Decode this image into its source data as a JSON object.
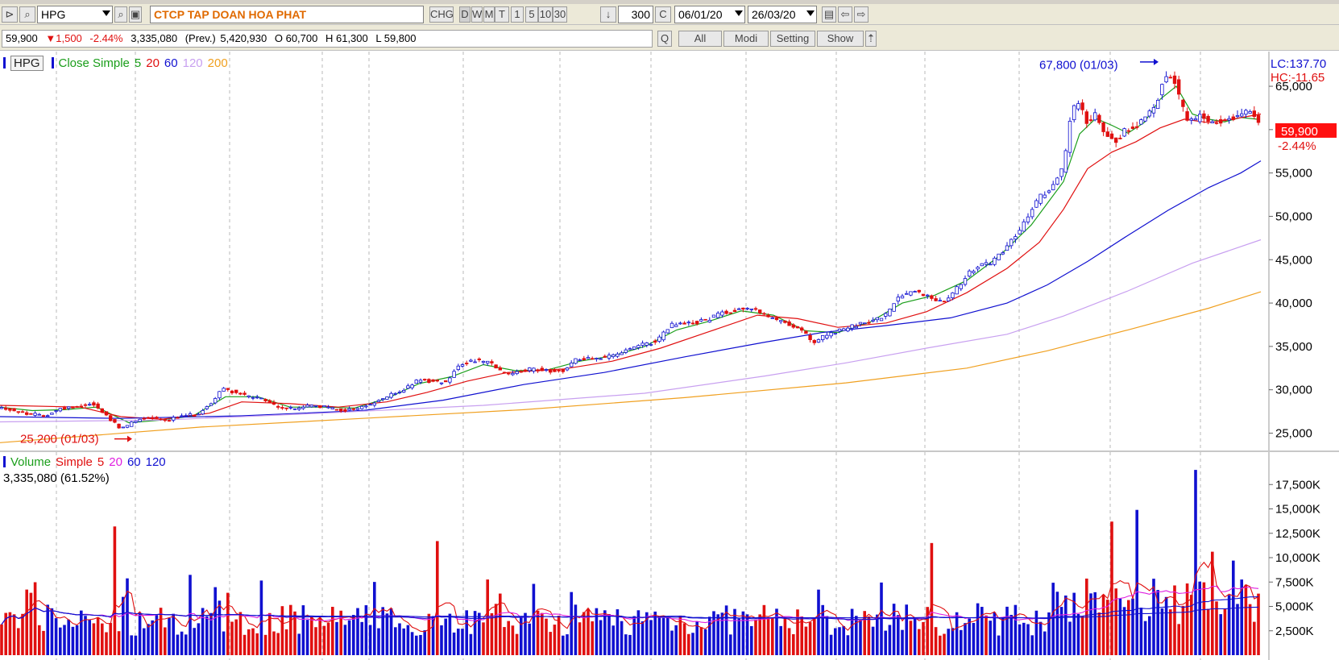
{
  "toolbar": {
    "symbol": "HPG",
    "company_name": "CTCP TAP DOAN HOA PHAT",
    "buttons": [
      "CHG",
      "D",
      "W",
      "M",
      "T",
      "1",
      "5",
      "10",
      "30"
    ],
    "bars_count": "300",
    "c_button": "C",
    "date_from": "06/01/20",
    "date_to": "26/03/20"
  },
  "quote": {
    "price": "59,900",
    "change": "▼1,500",
    "change_pct": "-2.44%",
    "volume": "3,335,080",
    "prev_label": "(Prev.)",
    "prev_volume": "5,420,930",
    "open": "O 60,700",
    "high": "H 61,300",
    "low": "L 59,800",
    "buttons": {
      "q": "Q",
      "all": "All",
      "modi": "Modi",
      "setting": "Setting",
      "show": "Show"
    }
  },
  "price_panel": {
    "symbol_badge": "HPG",
    "indicator": "Close Simple",
    "ma_periods": [
      "5",
      "20",
      "60",
      "120",
      "200"
    ],
    "ma_colors": [
      "#1a9e1a",
      "#e01010",
      "#1010d0",
      "#c8a0f0",
      "#f0a020"
    ],
    "lc_label": "LC:137.70",
    "hc_label": "HC:-11.65",
    "last_price": "59,900",
    "last_change_pct": "-2.44%",
    "high_annotation": "67,800 (01/03)",
    "low_annotation": "25,200 (01/03)",
    "y_ticks": [
      "65,000",
      "60,000",
      "55,000",
      "50,000",
      "45,000",
      "40,000",
      "35,000",
      "30,000",
      "25,000"
    ]
  },
  "volume_panel": {
    "title": "Volume",
    "indicator": "Simple",
    "ma_periods": [
      "5",
      "20",
      "60",
      "120"
    ],
    "ma_colors": [
      "#e01010",
      "#e020e0",
      "#1010d0",
      "#1010d0"
    ],
    "current_volume": "3,335,080 (61.52%)",
    "y_ticks": [
      "17,500K",
      "15,000K",
      "12,500K",
      "10,000K",
      "7,500K",
      "5,000K",
      "2,500K"
    ]
  },
  "chart_data": {
    "type": "candlestick",
    "price_ylim": [
      23000,
      69000
    ],
    "volume_ylim_k": [
      0,
      20000
    ],
    "price_path": [
      [
        0,
        28000
      ],
      [
        30,
        27300
      ],
      [
        55,
        27000
      ],
      [
        75,
        27800
      ],
      [
        95,
        28100
      ],
      [
        115,
        28400
      ],
      [
        135,
        26800
      ],
      [
        150,
        25400
      ],
      [
        165,
        26300
      ],
      [
        185,
        26900
      ],
      [
        205,
        26500
      ],
      [
        225,
        26900
      ],
      [
        245,
        27200
      ],
      [
        262,
        28400
      ],
      [
        275,
        30200
      ],
      [
        288,
        29800
      ],
      [
        305,
        29300
      ],
      [
        325,
        28900
      ],
      [
        345,
        28000
      ],
      [
        365,
        27800
      ],
      [
        385,
        28200
      ],
      [
        405,
        28000
      ],
      [
        425,
        27600
      ],
      [
        445,
        27900
      ],
      [
        465,
        28500
      ],
      [
        485,
        29400
      ],
      [
        505,
        30200
      ],
      [
        520,
        31200
      ],
      [
        540,
        30900
      ],
      [
        555,
        31000
      ],
      [
        570,
        33000
      ],
      [
        590,
        33400
      ],
      [
        610,
        33000
      ],
      [
        625,
        31800
      ],
      [
        645,
        32100
      ],
      [
        660,
        32400
      ],
      [
        680,
        32200
      ],
      [
        700,
        32200
      ],
      [
        715,
        33500
      ],
      [
        735,
        33700
      ],
      [
        755,
        33800
      ],
      [
        775,
        34400
      ],
      [
        795,
        35100
      ],
      [
        815,
        35600
      ],
      [
        835,
        37600
      ],
      [
        855,
        37600
      ],
      [
        875,
        38000
      ],
      [
        895,
        38800
      ],
      [
        915,
        39300
      ],
      [
        935,
        39500
      ],
      [
        955,
        38200
      ],
      [
        975,
        37800
      ],
      [
        995,
        36900
      ],
      [
        1010,
        35300
      ],
      [
        1025,
        36300
      ],
      [
        1045,
        36900
      ],
      [
        1065,
        37500
      ],
      [
        1085,
        38000
      ],
      [
        1100,
        38600
      ],
      [
        1115,
        40800
      ],
      [
        1135,
        41500
      ],
      [
        1155,
        40600
      ],
      [
        1170,
        40200
      ],
      [
        1185,
        41500
      ],
      [
        1200,
        43200
      ],
      [
        1215,
        44400
      ],
      [
        1230,
        44600
      ],
      [
        1245,
        46100
      ],
      [
        1260,
        47800
      ],
      [
        1275,
        49800
      ],
      [
        1290,
        52100
      ],
      [
        1305,
        53500
      ],
      [
        1320,
        55800
      ],
      [
        1330,
        62400
      ],
      [
        1340,
        62900
      ],
      [
        1350,
        60800
      ],
      [
        1360,
        62100
      ],
      [
        1372,
        59500
      ],
      [
        1385,
        58700
      ],
      [
        1395,
        59800
      ],
      [
        1410,
        60300
      ],
      [
        1425,
        62100
      ],
      [
        1435,
        63000
      ],
      [
        1445,
        66000
      ],
      [
        1455,
        66500
      ],
      [
        1465,
        63100
      ],
      [
        1475,
        60900
      ],
      [
        1490,
        61500
      ],
      [
        1505,
        60700
      ],
      [
        1520,
        61000
      ],
      [
        1535,
        61500
      ],
      [
        1545,
        62000
      ],
      [
        1555,
        61700
      ],
      [
        1565,
        60000
      ]
    ],
    "ma_series": [
      {
        "name": "5",
        "values": [
          [
            0,
            28000
          ],
          [
            40,
            27600
          ],
          [
            80,
            27700
          ],
          [
            120,
            28000
          ],
          [
            160,
            26200
          ],
          [
            200,
            26500
          ],
          [
            240,
            27000
          ],
          [
            280,
            29200
          ],
          [
            320,
            29200
          ],
          [
            360,
            28000
          ],
          [
            400,
            28000
          ],
          [
            440,
            27900
          ],
          [
            480,
            29000
          ],
          [
            520,
            30700
          ],
          [
            560,
            31500
          ],
          [
            600,
            32900
          ],
          [
            640,
            32200
          ],
          [
            680,
            32300
          ],
          [
            720,
            33300
          ],
          [
            760,
            33900
          ],
          [
            800,
            35000
          ],
          [
            840,
            36900
          ],
          [
            880,
            37900
          ],
          [
            920,
            39100
          ],
          [
            960,
            38600
          ],
          [
            1000,
            36800
          ],
          [
            1040,
            36600
          ],
          [
            1080,
            37800
          ],
          [
            1120,
            40000
          ],
          [
            1160,
            40900
          ],
          [
            1200,
            42600
          ],
          [
            1240,
            45400
          ],
          [
            1280,
            49000
          ],
          [
            1320,
            54000
          ],
          [
            1340,
            59500
          ],
          [
            1360,
            61300
          ],
          [
            1380,
            60500
          ],
          [
            1400,
            59600
          ],
          [
            1420,
            60800
          ],
          [
            1440,
            63500
          ],
          [
            1460,
            65000
          ],
          [
            1480,
            61800
          ],
          [
            1500,
            61200
          ],
          [
            1520,
            60900
          ],
          [
            1540,
            61400
          ],
          [
            1560,
            61200
          ]
        ]
      },
      {
        "name": "20",
        "values": [
          [
            0,
            28200
          ],
          [
            100,
            28000
          ],
          [
            150,
            26900
          ],
          [
            200,
            26600
          ],
          [
            260,
            27300
          ],
          [
            300,
            28600
          ],
          [
            360,
            28400
          ],
          [
            420,
            28000
          ],
          [
            480,
            28600
          ],
          [
            530,
            29700
          ],
          [
            580,
            31000
          ],
          [
            630,
            32000
          ],
          [
            700,
            32400
          ],
          [
            760,
            33300
          ],
          [
            820,
            34800
          ],
          [
            880,
            36700
          ],
          [
            940,
            38600
          ],
          [
            990,
            38200
          ],
          [
            1040,
            37200
          ],
          [
            1100,
            37700
          ],
          [
            1150,
            39000
          ],
          [
            1200,
            41200
          ],
          [
            1250,
            44000
          ],
          [
            1290,
            47000
          ],
          [
            1320,
            50800
          ],
          [
            1350,
            55500
          ],
          [
            1380,
            57400
          ],
          [
            1410,
            58600
          ],
          [
            1440,
            60200
          ],
          [
            1470,
            61200
          ],
          [
            1500,
            60800
          ],
          [
            1530,
            61200
          ],
          [
            1565,
            61800
          ]
        ]
      },
      {
        "name": "60",
        "values": [
          [
            0,
            26900
          ],
          [
            150,
            26700
          ],
          [
            300,
            27000
          ],
          [
            450,
            27600
          ],
          [
            550,
            28800
          ],
          [
            650,
            30600
          ],
          [
            750,
            32000
          ],
          [
            850,
            33800
          ],
          [
            950,
            35500
          ],
          [
            1020,
            36600
          ],
          [
            1100,
            37400
          ],
          [
            1180,
            38300
          ],
          [
            1250,
            40000
          ],
          [
            1300,
            42100
          ],
          [
            1350,
            44800
          ],
          [
            1400,
            47800
          ],
          [
            1450,
            50700
          ],
          [
            1500,
            53300
          ],
          [
            1540,
            55000
          ],
          [
            1565,
            56400
          ]
        ]
      },
      {
        "name": "120",
        "values": [
          [
            0,
            26300
          ],
          [
            200,
            26500
          ],
          [
            400,
            27300
          ],
          [
            600,
            28200
          ],
          [
            800,
            29600
          ],
          [
            950,
            31600
          ],
          [
            1050,
            33100
          ],
          [
            1150,
            34800
          ],
          [
            1250,
            36400
          ],
          [
            1320,
            38500
          ],
          [
            1400,
            41400
          ],
          [
            1480,
            44600
          ],
          [
            1565,
            47300
          ]
        ]
      },
      {
        "name": "200",
        "values": [
          [
            0,
            23900
          ],
          [
            250,
            25700
          ],
          [
            450,
            26700
          ],
          [
            650,
            27700
          ],
          [
            850,
            29100
          ],
          [
            1050,
            30800
          ],
          [
            1200,
            32500
          ],
          [
            1300,
            34500
          ],
          [
            1400,
            36900
          ],
          [
            1500,
            39400
          ],
          [
            1565,
            41300
          ]
        ]
      }
    ],
    "volume_peaks": [
      [
        145,
        13200
      ],
      [
        545,
        11700
      ],
      [
        1154,
        11500
      ],
      [
        1411,
        14900
      ],
      [
        1379,
        13700
      ],
      [
        1484,
        19000
      ],
      [
        1529,
        9700
      ]
    ]
  }
}
